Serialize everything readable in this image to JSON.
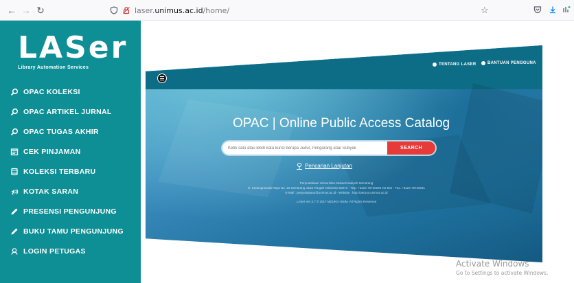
{
  "browser": {
    "url_prefix": "laser.",
    "url_domain": "unimus.ac.id",
    "url_path": "/home/",
    "icons": {
      "back": "arrow-left-icon",
      "forward": "arrow-right-icon",
      "reload": "reload-icon",
      "shield": "shield-icon",
      "lock": "lock-icon",
      "bookmark": "star-icon",
      "pocket": "pocket-icon",
      "download": "download-icon",
      "extensions": "extensions-icon"
    }
  },
  "sidebar": {
    "logo_text": "LASer",
    "logo_subtitle": "Library Automation Services",
    "items": [
      {
        "label": "OPAC KOLEKSI",
        "icon": "search-icon"
      },
      {
        "label": "OPAC ARTIKEL JURNAL",
        "icon": "search-icon"
      },
      {
        "label": "OPAC TUGAS AKHIR",
        "icon": "search-icon"
      },
      {
        "label": "CEK PINJAMAN",
        "icon": "calendar-icon"
      },
      {
        "label": "KOLEKSI TERBARU",
        "icon": "book-icon"
      },
      {
        "label": "KOTAK SARAN",
        "icon": "feedback-icon"
      },
      {
        "label": "PRESENSI PENGUNJUNG",
        "icon": "pencil-icon"
      },
      {
        "label": "BUKU TAMU PENGUNJUNG",
        "icon": "pencil-icon"
      },
      {
        "label": "LOGIN PETUGAS",
        "icon": "user-icon"
      }
    ]
  },
  "hero": {
    "links": [
      "TENTANG LASER",
      "BANTUAN PENGGUNA"
    ],
    "title": "OPAC | Online Public Access Catalog",
    "search_placeholder": "Ketik satu atau lebih kata kunci berupa Judul, Pengarang atau Subyek",
    "search_button": "SEARCH",
    "advanced_search": "Pencarian Lanjutan",
    "footer": [
      "Perpustakaan Universitas Muhammadiyah Semarang",
      "Jl. Kedungmundu Raya No. 18 Semarang Jawa Tengah Indonesia 50272 - Telp. +6224 76740296 ext 502 - Fax. +6224 76740291",
      "E-Mail : perpustakaan@unimus.ac.id - Website : http://perpus.unimus.ac.id",
      "LASer Ver 3.7 © 2017 MDUKG-UNIM. All Rights Reserved"
    ]
  },
  "watermark": {
    "line1": "Activate Windows",
    "line2": "Go to Settings to activate Windows."
  },
  "colors": {
    "sidebar": "#0e8f95",
    "hero_bar": "#0d6d87",
    "search_button": "#e63b38"
  }
}
